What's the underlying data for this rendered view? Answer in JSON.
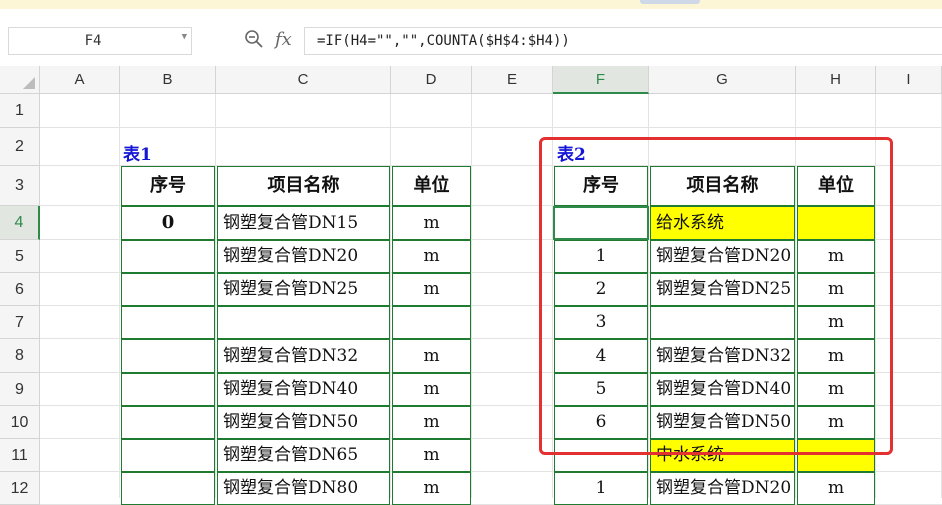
{
  "formula_bar": {
    "name_box": "F4",
    "zoom_icon": "zoom-icon",
    "fx_label": "fx",
    "formula": "=IF(H4=\"\",\"\",COUNTA($H$4:$H4))"
  },
  "columns": [
    "A",
    "B",
    "C",
    "D",
    "E",
    "F",
    "G",
    "H",
    "I"
  ],
  "rows": [
    "1",
    "2",
    "3",
    "4",
    "5",
    "6",
    "7",
    "8",
    "9",
    "10",
    "11",
    "12"
  ],
  "selected_cell": "F4",
  "table1": {
    "title": "表1",
    "headers": [
      "序号",
      "项目名称",
      "单位"
    ],
    "rows": [
      {
        "seq": "0",
        "name": "钢塑复合管DN15",
        "unit": "m"
      },
      {
        "seq": "",
        "name": "钢塑复合管DN20",
        "unit": "m"
      },
      {
        "seq": "",
        "name": "钢塑复合管DN25",
        "unit": "m"
      },
      {
        "seq": "",
        "name": "",
        "unit": ""
      },
      {
        "seq": "",
        "name": "钢塑复合管DN32",
        "unit": "m"
      },
      {
        "seq": "",
        "name": "钢塑复合管DN40",
        "unit": "m"
      },
      {
        "seq": "",
        "name": "钢塑复合管DN50",
        "unit": "m"
      },
      {
        "seq": "",
        "name": "钢塑复合管DN65",
        "unit": "m"
      },
      {
        "seq": "",
        "name": "钢塑复合管DN80",
        "unit": "m"
      }
    ]
  },
  "table2": {
    "title": "表2",
    "headers": [
      "序号",
      "项目名称",
      "单位"
    ],
    "rows": [
      {
        "seq": "",
        "name": "给水系统",
        "unit": "",
        "highlight": true
      },
      {
        "seq": "1",
        "name": "钢塑复合管DN20",
        "unit": "m"
      },
      {
        "seq": "2",
        "name": "钢塑复合管DN25",
        "unit": "m"
      },
      {
        "seq": "3",
        "name": "",
        "unit": "m"
      },
      {
        "seq": "4",
        "name": "钢塑复合管DN32",
        "unit": "m"
      },
      {
        "seq": "5",
        "name": "钢塑复合管DN40",
        "unit": "m"
      },
      {
        "seq": "6",
        "name": "钢塑复合管DN50",
        "unit": "m"
      },
      {
        "seq": "",
        "name": "中水系统",
        "unit": "",
        "highlight": true
      },
      {
        "seq": "1",
        "name": "钢塑复合管DN20",
        "unit": "m"
      }
    ]
  },
  "colors": {
    "table_border": "#1e7b2f",
    "highlight": "#ffff00",
    "title_text": "#1515d6",
    "annotation": "#e33131",
    "selection": "#2f8a4a"
  }
}
